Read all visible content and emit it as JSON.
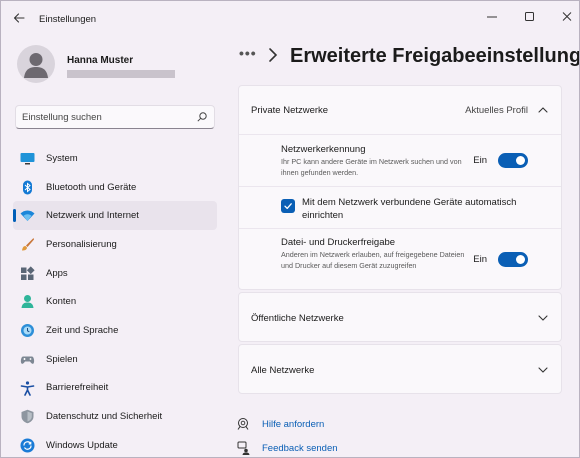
{
  "window": {
    "title": "Einstellungen"
  },
  "user": {
    "name": "Hanna Muster"
  },
  "search": {
    "placeholder": "Einstellung suchen"
  },
  "sidebar": {
    "items": [
      {
        "label": "System",
        "icon": "monitor-icon"
      },
      {
        "label": "Bluetooth und Geräte",
        "icon": "bluetooth-icon"
      },
      {
        "label": "Netzwerk und Internet",
        "icon": "wifi-icon",
        "active": true
      },
      {
        "label": "Personalisierung",
        "icon": "paintbrush-icon"
      },
      {
        "label": "Apps",
        "icon": "apps-icon"
      },
      {
        "label": "Konten",
        "icon": "person-icon"
      },
      {
        "label": "Zeit und Sprache",
        "icon": "globe-clock-icon"
      },
      {
        "label": "Spielen",
        "icon": "gamepad-icon"
      },
      {
        "label": "Barrierefreiheit",
        "icon": "accessibility-icon"
      },
      {
        "label": "Datenschutz und Sicherheit",
        "icon": "shield-icon"
      },
      {
        "label": "Windows Update",
        "icon": "update-icon"
      }
    ]
  },
  "header": {
    "breadcrumb_overflow": "•••",
    "title": "Erweiterte Freigabeeinstellung"
  },
  "private": {
    "title": "Private Netzwerke",
    "badge": "Aktuelles Profil",
    "discovery": {
      "title": "Netzwerkerkennung",
      "description": "Ihr PC kann andere Geräte im Netzwerk suchen und von ihnen gefunden werden.",
      "state": "Ein"
    },
    "auto_setup": {
      "label": "Mit dem Netzwerk verbundene Geräte automatisch einrichten",
      "checked": true
    },
    "sharing": {
      "title": "Datei- und Druckerfreigabe",
      "description": "Anderen im Netzwerk erlauben, auf freigegebene Dateien und Drucker auf diesem Gerät zuzugreifen",
      "state": "Ein"
    }
  },
  "public": {
    "title": "Öffentliche Netzwerke"
  },
  "all": {
    "title": "Alle Netzwerke"
  },
  "footer": {
    "help": "Hilfe anfordern",
    "feedback": "Feedback senden"
  },
  "colors": {
    "accent": "#0a5fb5",
    "background": "#f4eff6",
    "card": "#faf8fb"
  }
}
